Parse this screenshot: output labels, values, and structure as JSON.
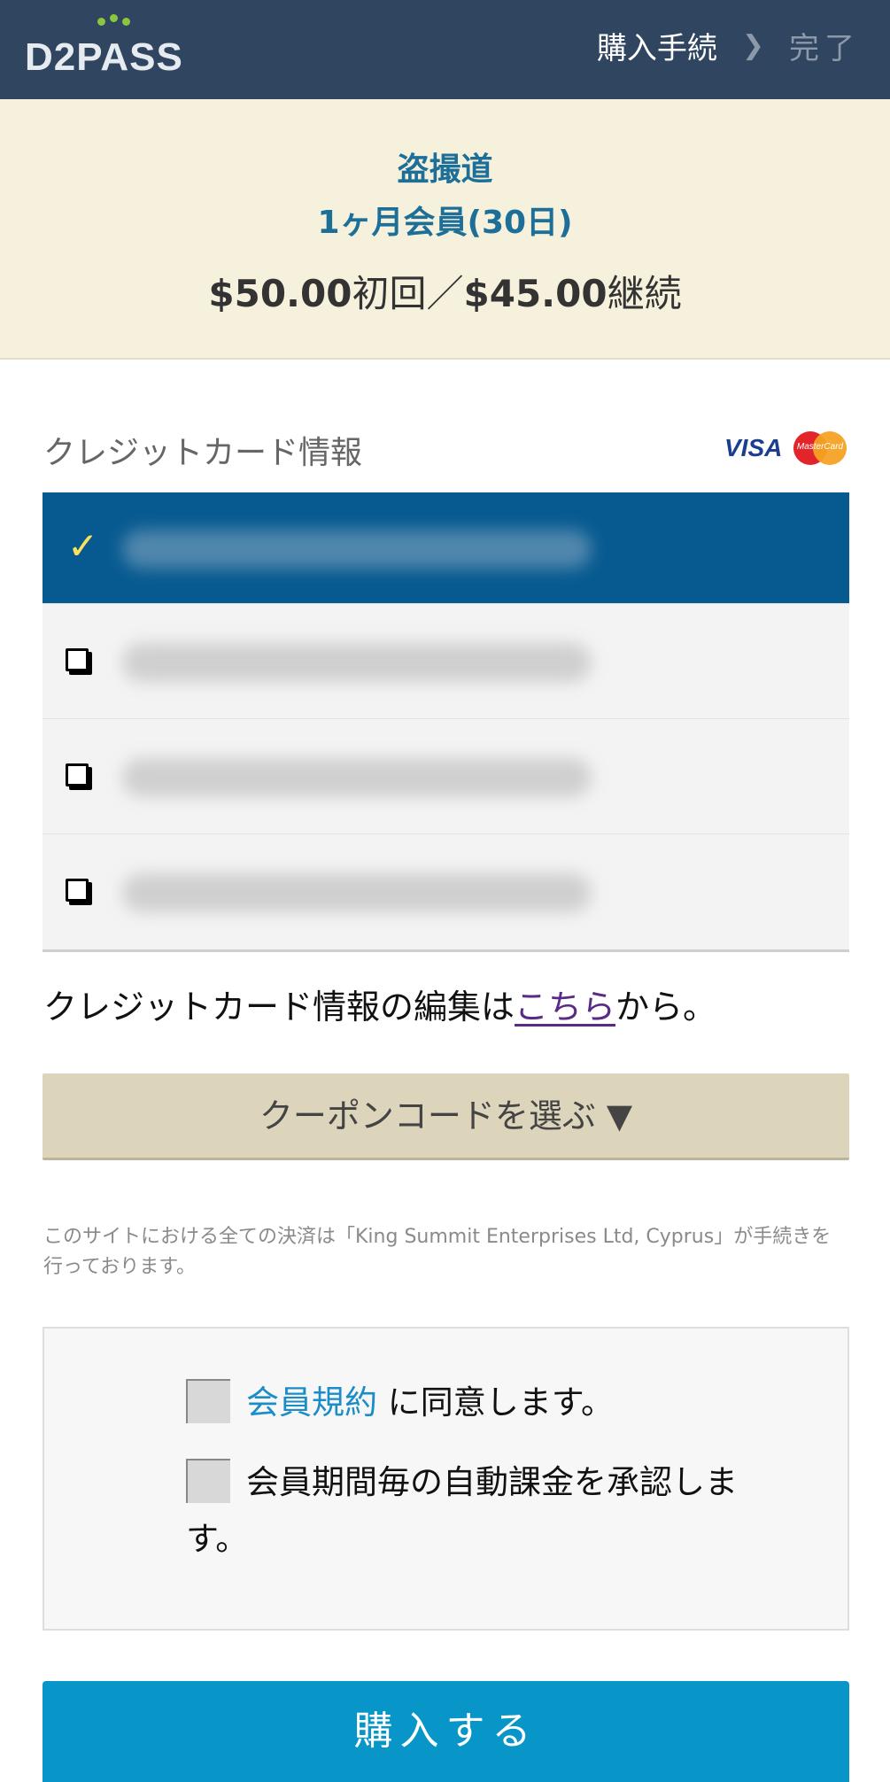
{
  "header": {
    "logo": "D2PASS",
    "steps": {
      "current": "購入手続",
      "separator": "❯",
      "next": "完了"
    }
  },
  "product": {
    "name": "盗撮道",
    "plan": "1ヶ月会員(30日)",
    "price_initial": "$50.00",
    "price_initial_label": "初回",
    "price_separator": "／",
    "price_renewal": "$45.00",
    "price_renewal_label": "継続"
  },
  "card_section": {
    "title": "クレジットカード情報",
    "brands": {
      "visa": "VISA",
      "mastercard": "MasterCard"
    },
    "cards": [
      {
        "selected": true,
        "icon": "check-icon"
      },
      {
        "selected": false,
        "icon": "checkbox-icon"
      },
      {
        "selected": false,
        "icon": "checkbox-icon"
      },
      {
        "selected": false,
        "icon": "checkbox-icon"
      }
    ],
    "check_glyph": "✓",
    "edit_prefix": "クレジットカード情報の編集は",
    "edit_link": "こちら",
    "edit_suffix": "から。"
  },
  "coupon": {
    "label": "クーポンコードを選ぶ ▼"
  },
  "notice": "このサイトにおける全ての決済は「King Summit Enterprises Ltd, Cyprus」が手続きを行っております。",
  "agreements": {
    "terms_link": "会員規約",
    "terms_suffix": " に同意します。",
    "auto_billing": "会員期間毎の自動課金を承認します。"
  },
  "purchase_button": "購入する",
  "colors": {
    "header_bg": "#2f4560",
    "banner_bg": "#f6f1dc",
    "selected_card_bg": "#075a90",
    "coupon_bg": "#dcd5bc",
    "buy_button_bg": "#0895c8",
    "accent_text": "#1d6f98"
  }
}
